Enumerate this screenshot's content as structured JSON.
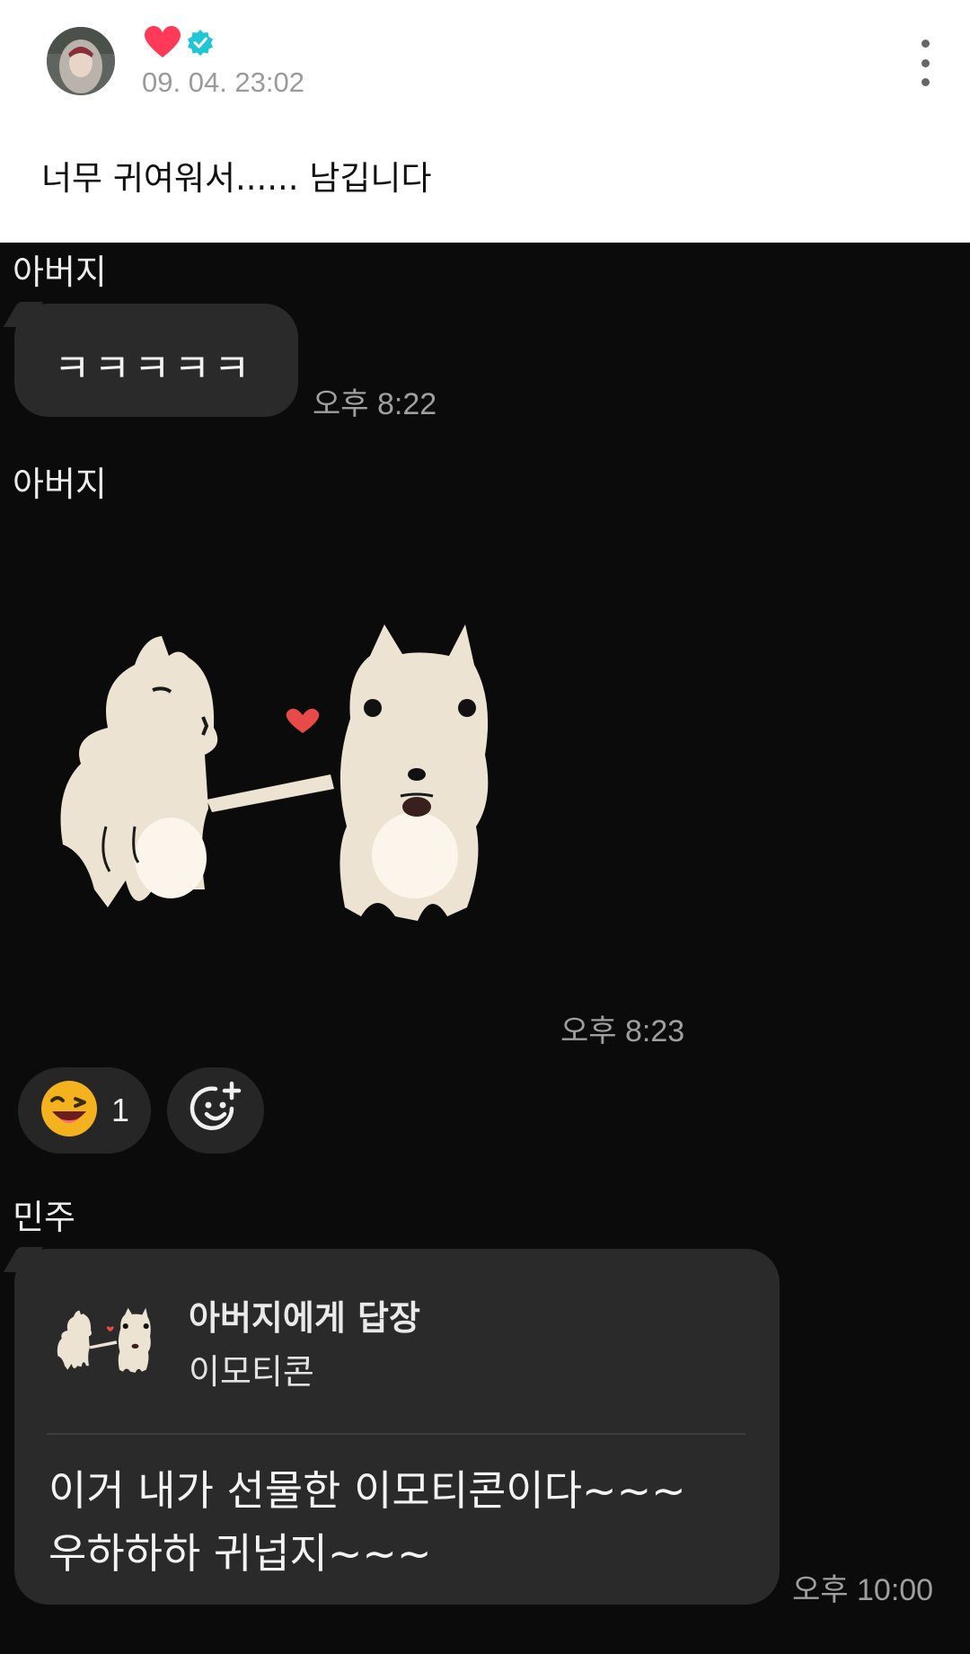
{
  "post": {
    "date": "09. 04. 23:02",
    "caption": "너무 귀여워서...... 남깁니다",
    "name_icon": "heart-icon",
    "verified_icon": "verified-badge-icon",
    "heart_color": "#ff3a58",
    "verified_color": "#1fc7d4"
  },
  "chat": {
    "messages": [
      {
        "sender": "아버지",
        "text": "ㅋㅋㅋㅋㅋ",
        "time": "오후 8:22"
      },
      {
        "sender": "아버지",
        "sticker": "two-cats-sticker",
        "time": "오후 8:23",
        "reactions": [
          {
            "emoji": "laughing-emoji-icon",
            "count": "1"
          }
        ],
        "add_reaction_icon": "add-reaction-icon"
      },
      {
        "sender": "민주",
        "reply_to": "아버지에게 답장",
        "reply_type": "이모티콘",
        "lines": [
          "이거 내가 선물한 이모티콘이다~~~",
          "우하하하 귀넙지~~~"
        ],
        "time": "오후 10:00"
      }
    ]
  }
}
